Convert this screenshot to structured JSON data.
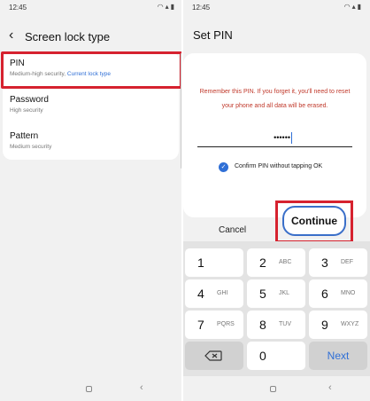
{
  "left_screen": {
    "status_time": "12:45",
    "title": "Screen lock type",
    "options": [
      {
        "label": "PIN",
        "sub": "Medium-high security, ",
        "sub_link": "Current lock type"
      },
      {
        "label": "Password",
        "sub": "High security"
      },
      {
        "label": "Pattern",
        "sub": "Medium security"
      }
    ]
  },
  "right_screen": {
    "status_time": "12:45",
    "title": "Set PIN",
    "warning": "Remember this PIN. If you forget it, you'll need to reset your phone and all data will be erased.",
    "pin_masked": "••••••",
    "confirm_label": "Confirm PIN without tapping OK",
    "confirm_checked": true,
    "cancel_label": "Cancel",
    "continue_label": "Continue",
    "keys": [
      {
        "digit": "1",
        "letters": ""
      },
      {
        "digit": "2",
        "letters": "ABC"
      },
      {
        "digit": "3",
        "letters": "DEF"
      },
      {
        "digit": "4",
        "letters": "GHI"
      },
      {
        "digit": "5",
        "letters": "JKL"
      },
      {
        "digit": "6",
        "letters": "MNO"
      },
      {
        "digit": "7",
        "letters": "PQRS"
      },
      {
        "digit": "8",
        "letters": "TUV"
      },
      {
        "digit": "9",
        "letters": "WXYZ"
      },
      {
        "digit": "0",
        "letters": ""
      }
    ],
    "next_label": "Next"
  },
  "colors": {
    "highlight_red": "#d6222f",
    "accent_blue": "#2f6fd6",
    "warning_red": "#c0392b"
  }
}
